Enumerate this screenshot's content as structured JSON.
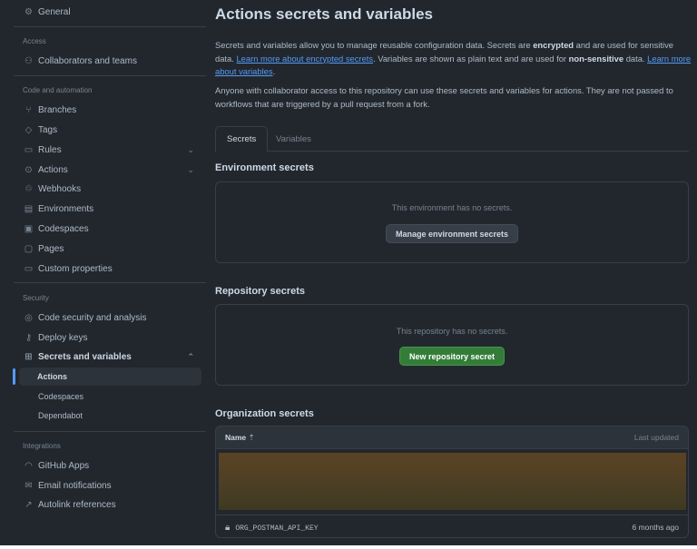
{
  "sidebar": {
    "general": "General",
    "access_header": "Access",
    "collaborators": "Collaborators and teams",
    "code_header": "Code and automation",
    "branches": "Branches",
    "tags": "Tags",
    "rules": "Rules",
    "actions": "Actions",
    "webhooks": "Webhooks",
    "environments": "Environments",
    "codespaces": "Codespaces",
    "pages": "Pages",
    "custom_properties": "Custom properties",
    "security_header": "Security",
    "code_security": "Code security and analysis",
    "deploy_keys": "Deploy keys",
    "secrets_vars": "Secrets and variables",
    "sub_actions": "Actions",
    "sub_codespaces": "Codespaces",
    "sub_dependabot": "Dependabot",
    "integrations_header": "Integrations",
    "github_apps": "GitHub Apps",
    "email_notifications": "Email notifications",
    "autolink": "Autolink references"
  },
  "main": {
    "title": "Actions secrets and variables",
    "p1": {
      "a": "Secrets and variables allow you to manage reusable configuration data. Secrets are ",
      "b": "encrypted",
      "c": " and are used for sensitive data. ",
      "link1": "Learn more about encrypted secrets",
      "d": ". Variables are shown as plain text and are used for ",
      "e": "non-sensitive",
      "f": " data. ",
      "link2": "Learn more about variables",
      "g": "."
    },
    "p2": "Anyone with collaborator access to this repository can use these secrets and variables for actions. They are not passed to workflows that are triggered by a pull request from a fork.",
    "tabs": [
      "Secrets",
      "Variables"
    ],
    "env": {
      "heading": "Environment secrets",
      "empty": "This environment has no secrets.",
      "button": "Manage environment secrets"
    },
    "repo": {
      "heading": "Repository secrets",
      "empty": "This repository has no secrets.",
      "button": "New repository secret"
    },
    "org": {
      "heading": "Organization secrets",
      "col_name": "Name",
      "col_updated": "Last updated",
      "rows": [
        {
          "name": "ORG_POSTMAN_API_KEY",
          "updated": "6 months ago"
        }
      ]
    }
  }
}
